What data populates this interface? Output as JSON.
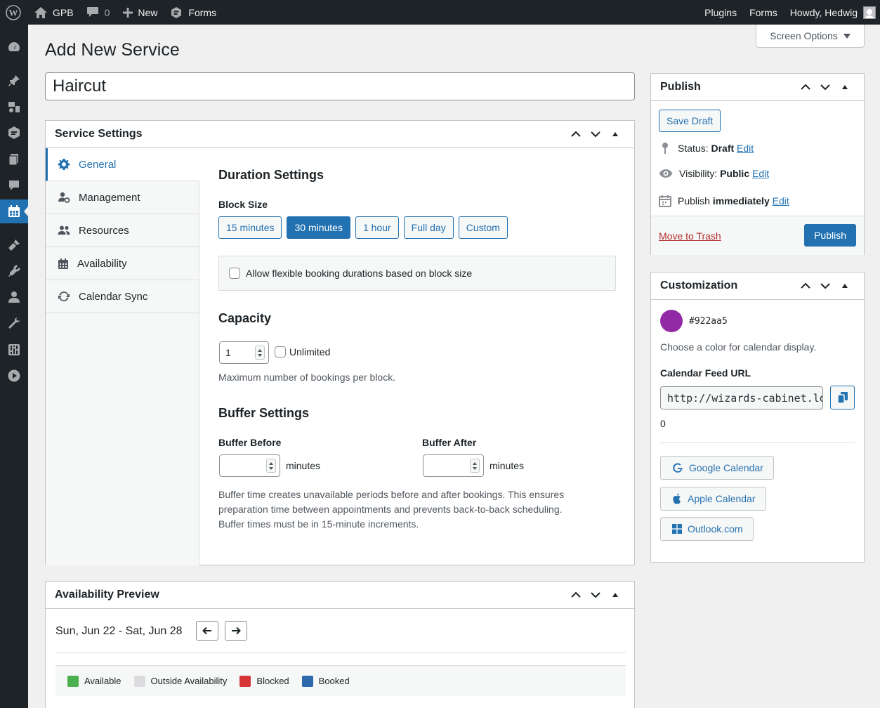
{
  "adminbar": {
    "site_name": "GPB",
    "comments_count": "0",
    "new_label": "New",
    "forms_label": "Forms",
    "plugins_label": "Plugins",
    "forms_right_label": "Forms",
    "greeting": "Howdy, Hedwig"
  },
  "screen_options": "Screen Options",
  "page_title": "Add New Service",
  "post_title": "Haircut",
  "service_settings": {
    "title": "Service Settings",
    "tabs": [
      {
        "label": "General",
        "icon": "gear-icon"
      },
      {
        "label": "Management",
        "icon": "user-gear-icon"
      },
      {
        "label": "Resources",
        "icon": "group-icon"
      },
      {
        "label": "Availability",
        "icon": "calendar-icon"
      },
      {
        "label": "Calendar Sync",
        "icon": "sync-icon"
      }
    ],
    "duration_heading": "Duration Settings",
    "block_size_label": "Block Size",
    "block_options": [
      "15 minutes",
      "30 minutes",
      "1 hour",
      "Full day",
      "Custom"
    ],
    "block_selected": "30 minutes",
    "flexible_label": "Allow flexible booking durations based on block size",
    "capacity_heading": "Capacity",
    "capacity_value": "1",
    "unlimited_label": "Unlimited",
    "capacity_help": "Maximum number of bookings per block.",
    "buffer_heading": "Buffer Settings",
    "buffer_before_label": "Buffer Before",
    "buffer_after_label": "Buffer After",
    "minutes_label": "minutes",
    "buffer_help_1": "Buffer time creates unavailable periods before and after bookings. This ensures",
    "buffer_help_2": "preparation time between appointments and prevents back-to-back scheduling.",
    "buffer_help_3": "Buffer times must be in 15-minute increments."
  },
  "publish": {
    "title": "Publish",
    "save_draft": "Save Draft",
    "status_label": "Status:",
    "status_value": "Draft",
    "visibility_label": "Visibility:",
    "visibility_value": "Public",
    "publish_label": "Publish",
    "publish_value": "immediately",
    "edit": "Edit",
    "trash": "Move to Trash",
    "publish_button": "Publish"
  },
  "customization": {
    "title": "Customization",
    "color": "#922aa5",
    "color_help": "Choose a color for calendar display.",
    "feed_label": "Calendar Feed URL",
    "feed_url": "http://wizards-cabinet.lo",
    "feed_extra": "0",
    "google": "Google Calendar",
    "apple": "Apple Calendar",
    "outlook": "Outlook.com"
  },
  "preview": {
    "title": "Availability Preview",
    "range": "Sun, Jun 22 - Sat, Jun 28",
    "legend": [
      {
        "label": "Available",
        "color": "#4caf50"
      },
      {
        "label": "Outside Availability",
        "color": "#dcdcde"
      },
      {
        "label": "Blocked",
        "color": "#d63638"
      },
      {
        "label": "Booked",
        "color": "#2c6aad"
      }
    ]
  },
  "colors": {
    "accent": "#2271b1",
    "adminbar": "#1d2327"
  }
}
